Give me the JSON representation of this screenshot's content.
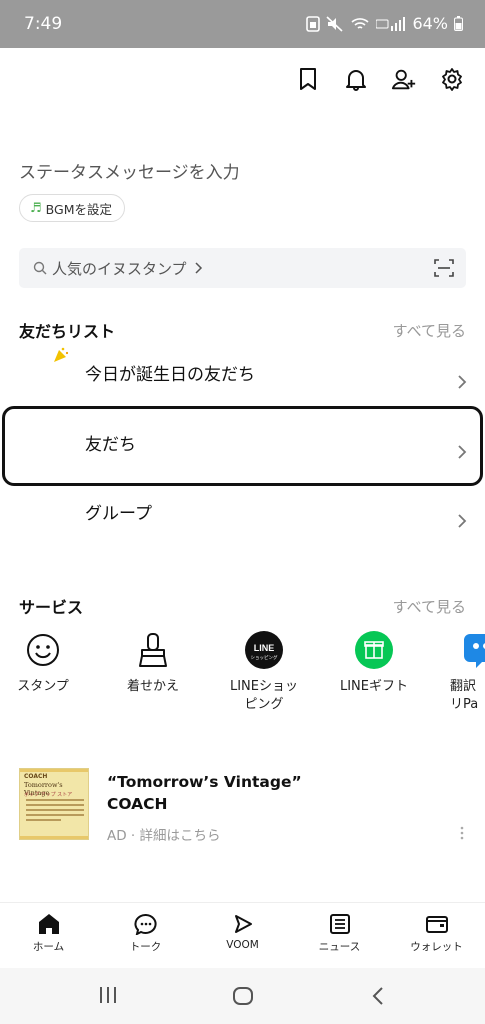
{
  "status_bar": {
    "time": "7:49",
    "battery": "64%"
  },
  "profile": {
    "status_message_placeholder": "ステータスメッセージを入力",
    "bgm_button": "BGMを設定"
  },
  "search": {
    "placeholder": "人気のイヌスタンプ"
  },
  "friends_section": {
    "title": "友だちリスト",
    "see_all": "すべて見る",
    "rows": [
      {
        "label": "今日が誕生日の友だち"
      },
      {
        "label": "友だち"
      },
      {
        "label": "グループ"
      }
    ]
  },
  "services_section": {
    "title": "サービス",
    "see_all": "すべて見る",
    "items": [
      {
        "label": "スタンプ",
        "icon": "smiley-icon"
      },
      {
        "label": "着せかえ",
        "icon": "brush-icon"
      },
      {
        "label": "LINEショッピング",
        "icon": "line-shopping-icon",
        "badge_top": "LINE",
        "badge_bottom": "ショッピング"
      },
      {
        "label": "LINEギフト",
        "icon": "gift-icon"
      },
      {
        "label": "翻訳リPa",
        "icon": "translate-icon"
      }
    ]
  },
  "ad": {
    "title_line1": "“Tomorrow’s Vintage”",
    "title_line2": "COACH",
    "meta": "AD · 詳細はこちら",
    "thumb_brand": "COACH",
    "thumb_title": "Tomorrow's Vintage",
    "thumb_sub": "ポップ アップ ストア"
  },
  "bottom_nav": [
    {
      "label": "ホーム",
      "icon": "home-icon",
      "active": true
    },
    {
      "label": "トーク",
      "icon": "chat-icon"
    },
    {
      "label": "VOOM",
      "icon": "voom-icon"
    },
    {
      "label": "ニュース",
      "icon": "news-icon"
    },
    {
      "label": "ウォレット",
      "icon": "wallet-icon"
    }
  ],
  "colors": {
    "status_bar": "#9a9a9a",
    "line_green": "#06c755",
    "muted": "#999999",
    "highlight_border": "#111111"
  }
}
